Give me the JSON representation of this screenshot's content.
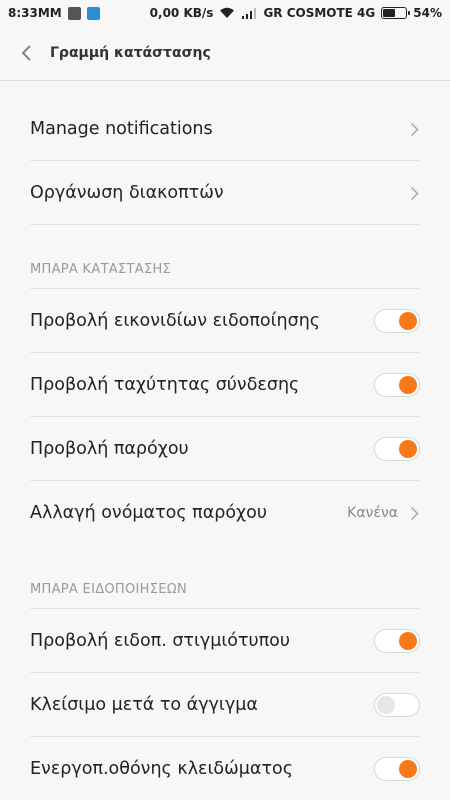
{
  "status_bar": {
    "time": "8:33MM",
    "net_speed": "0,00 KB/s",
    "carrier": "GR COSMOTE 4G",
    "battery": "54%",
    "battery_level": 0.54
  },
  "header": {
    "title": "Γραμμή κατάστασης"
  },
  "top_items": [
    {
      "label": "Manage notifications"
    },
    {
      "label": "Οργάνωση διακοπτών"
    }
  ],
  "section_status": {
    "title": "ΜΠΑΡΑ ΚΑΤΑΣΤΑΣΗΣ",
    "items": [
      {
        "label": "Προβολή εικονιδίων ειδοποίησης",
        "toggle": "on"
      },
      {
        "label": "Προβολή ταχύτητας σύνδεσης",
        "toggle": "on"
      },
      {
        "label": "Προβολή παρόχου",
        "toggle": "on"
      },
      {
        "label": "Αλλαγή ονόματος παρόχου",
        "value": "Κανένα"
      }
    ]
  },
  "section_notifications": {
    "title": "ΜΠΑΡΑ ΕΙΔΟΠΟΙΗΣΕΩΝ",
    "items": [
      {
        "label": "Προβολή ειδοπ. στιγμιότυπου",
        "toggle": "on"
      },
      {
        "label": "Κλείσιμο μετά το άγγιγμα",
        "toggle": "off"
      },
      {
        "label": "Ενεργοπ.οθόνης κλειδώματος",
        "toggle": "on"
      }
    ]
  },
  "colors": {
    "accent": "#f7781b",
    "background": "#f7f7f7"
  }
}
